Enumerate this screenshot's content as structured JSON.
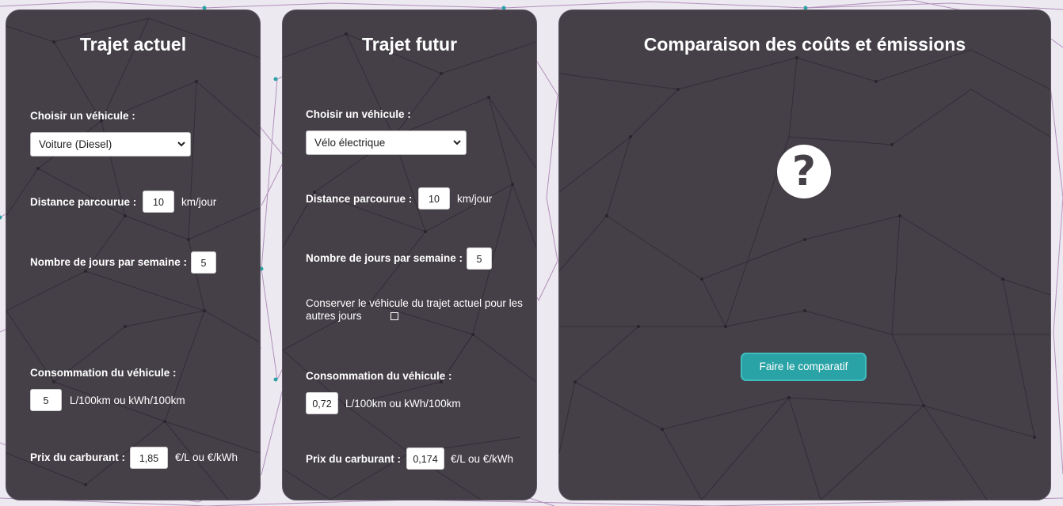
{
  "current_trip": {
    "title": "Trajet actuel",
    "vehicle_label": "Choisir un véhicule :",
    "vehicle_value": "Voiture (Diesel)",
    "distance_label": "Distance parcourue :",
    "distance_value": "10",
    "distance_unit": "km/jour",
    "days_label": "Nombre de jours par semaine :",
    "days_value": "5",
    "consumption_label": "Consommation du véhicule :",
    "consumption_value": "5",
    "consumption_unit": "L/100km ou kWh/100km",
    "fuel_price_label": "Prix du carburant :",
    "fuel_price_value": "1,85",
    "fuel_price_unit": "€/L ou €/kWh"
  },
  "future_trip": {
    "title": "Trajet futur",
    "vehicle_label": "Choisir un véhicule :",
    "vehicle_value": "Vélo électrique",
    "distance_label": "Distance parcourue :",
    "distance_value": "10",
    "distance_unit": "km/jour",
    "days_label": "Nombre de jours par semaine :",
    "days_value": "5",
    "keep_vehicle_label": "Conserver le véhicule du trajet actuel pour les autres jours",
    "keep_vehicle_checked": false,
    "consumption_label": "Consommation du véhicule :",
    "consumption_value": "0,72",
    "consumption_unit": "L/100km ou kWh/100km",
    "fuel_price_label": "Prix du carburant :",
    "fuel_price_value": "0,174",
    "fuel_price_unit": "€/L ou €/kWh"
  },
  "comparison": {
    "title": "Comparaison des coûts et émissions",
    "help_icon": "?",
    "compare_button": "Faire le comparatif"
  },
  "colors": {
    "panel": "#454048",
    "background": "#ede9f0",
    "accent": "#2aa3a6",
    "lines": "#8a4f9a"
  }
}
